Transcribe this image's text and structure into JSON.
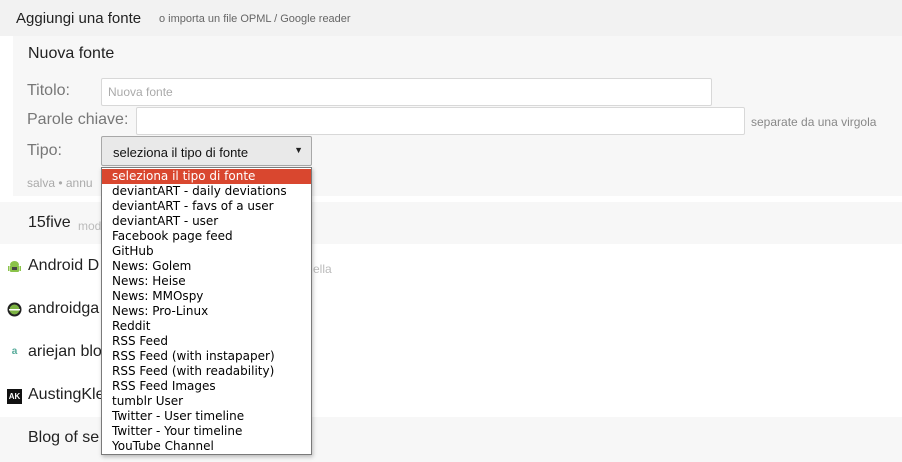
{
  "header": {
    "title": "Aggiungi una fonte",
    "subtitle": "o importa un file OPML / Google reader"
  },
  "form": {
    "title": "Nuova fonte",
    "title_label": "Titolo:",
    "title_placeholder": "Nuova fonte",
    "tags_label": "Parole chiave:",
    "tags_hint": "separate da una virgola",
    "type_label": "Tipo:",
    "type_selected": "seleziona il tipo di fonte",
    "actions": "salva • annu"
  },
  "dropdown": {
    "options": [
      "seleziona il tipo di fonte",
      "deviantART - daily deviations",
      "deviantART - favs of a user",
      "deviantART - user",
      "Facebook page feed",
      "GitHub",
      "News: Golem",
      "News: Heise",
      "News: MMOspy",
      "News: Pro-Linux",
      "Reddit",
      "RSS Feed",
      "RSS Feed (with instapaper)",
      "RSS Feed (with readability)",
      "RSS Feed Images",
      "tumblr User",
      "Twitter - User timeline",
      "Twitter - Your timeline",
      "YouTube Channel"
    ],
    "selected_index": 0,
    "selected_color": "#d9472f"
  },
  "feeds": [
    {
      "name": "15five",
      "meta": "mod",
      "icon": ""
    },
    {
      "name": "Android D",
      "meta": "ella",
      "icon": "android-icon"
    },
    {
      "name": "androidga",
      "meta": "",
      "icon": "green-circle-icon"
    },
    {
      "name": "ariejan blo",
      "meta": "",
      "icon": "letter-a-icon"
    },
    {
      "name": "AustingKle",
      "meta": "",
      "icon": "ak-icon"
    },
    {
      "name": "Blog of se",
      "meta": "",
      "icon": ""
    }
  ]
}
